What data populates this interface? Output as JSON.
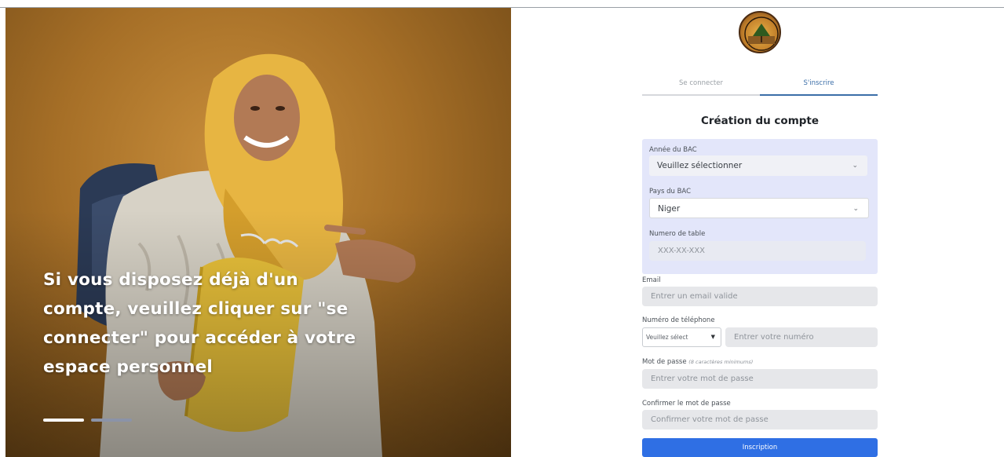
{
  "hero": {
    "message": "Si vous disposez déjà d'un compte, veuillez cliquer sur \"se connecter\" pour accéder à votre espace personnel",
    "slides": 2,
    "active_slide": 1
  },
  "tabs": [
    {
      "label": "Se connecter",
      "active": false
    },
    {
      "label": "S'inscrire",
      "active": true
    }
  ],
  "form": {
    "title": "Création du compte",
    "bac_year": {
      "label": "Année du BAC",
      "value": "Veuillez sélectionner"
    },
    "bac_country": {
      "label": "Pays du BAC",
      "value": "Niger"
    },
    "table_number": {
      "label": "Numero de table",
      "placeholder": "XXX-XX-XXX"
    },
    "email": {
      "label": "Email",
      "placeholder": "Entrer un email valide"
    },
    "phone": {
      "label": "Numéro de téléphone",
      "code_value": "Veuillez sélect",
      "placeholder": "Entrer votre numéro"
    },
    "password": {
      "label": "Mot de passe",
      "hint": "(8 caractères minimums)",
      "placeholder": "Entrer votre mot de passe"
    },
    "confirm_password": {
      "label": "Confirmer le mot de passe",
      "placeholder": "Confirmer votre mot de passe"
    },
    "submit_label": "Inscription"
  },
  "colors": {
    "accent": "#2f6fe4",
    "tab_active": "#3b6ea8",
    "panel_bg": "#e3e6fa"
  },
  "icons": {
    "logo": "university-seal-logo",
    "dropdown": "chevron-down-icon",
    "phone_dropdown": "caret-down-icon"
  }
}
